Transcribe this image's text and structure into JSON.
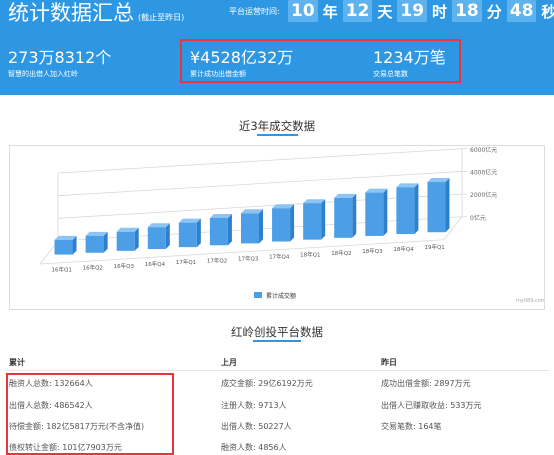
{
  "header": {
    "title": "统计数据汇总",
    "title_note": "(截止至昨日)",
    "runtime_label": "平台运营时间:",
    "runtime": [
      {
        "value": "10",
        "unit": "年"
      },
      {
        "value": "12",
        "unit": "天"
      },
      {
        "value": "19",
        "unit": "时"
      },
      {
        "value": "18",
        "unit": "分"
      },
      {
        "value": "48",
        "unit": "秒"
      }
    ],
    "stats": [
      {
        "value": "273万8312个",
        "label": "智慧的出借人加入红岭"
      },
      {
        "value": "¥4528亿32万",
        "label": "累计成功出借金额"
      },
      {
        "value": "1234万笔",
        "label": "交易总笔数"
      }
    ],
    "highlight_color": "#e8363b",
    "brand_color": "#2e97e4"
  },
  "chart_section": {
    "title": "近3年成交数据",
    "watermark": "my089.com"
  },
  "chart_data": {
    "type": "bar",
    "title": "近3年成交数据",
    "categories": [
      "16年Q1",
      "16年Q2",
      "16年Q3",
      "16年Q4",
      "17年Q1",
      "17年Q2",
      "17年Q3",
      "17年Q4",
      "18年Q1",
      "18年Q2",
      "18年Q3",
      "18年Q4",
      "19年Q1"
    ],
    "series": [
      {
        "name": "累计成交额",
        "values": [
          1200,
          1380,
          1560,
          1780,
          2000,
          2230,
          2460,
          2720,
          2980,
          3260,
          3540,
          3820,
          4100
        ],
        "color": "#4c9ee7"
      }
    ],
    "y_ticks": [
      "0亿元",
      "2000亿元",
      "4000亿元",
      "6000亿元"
    ],
    "ylim": [
      0,
      6000
    ],
    "grid": true,
    "legend": "bottom"
  },
  "platform_section": {
    "title": "红岭创投平台数据",
    "columns": [
      {
        "heading": "累计",
        "rows": [
          "融资人总数: 132664人",
          "出借人总数: 486542人",
          "待偿金额: 182亿5817万元(不含净值)",
          "债权转让金额: 101亿7903万元"
        ]
      },
      {
        "heading": "上月",
        "rows": [
          "成交金额: 29亿6192万元",
          "注册人数: 9713人",
          "出借人数: 50227人",
          "融资人数: 4856人"
        ]
      },
      {
        "heading": "昨日",
        "rows": [
          "成功出借金额: 2897万元",
          "出借人已赚取收益: 533万元",
          "交易笔数: 164笔"
        ]
      }
    ]
  }
}
